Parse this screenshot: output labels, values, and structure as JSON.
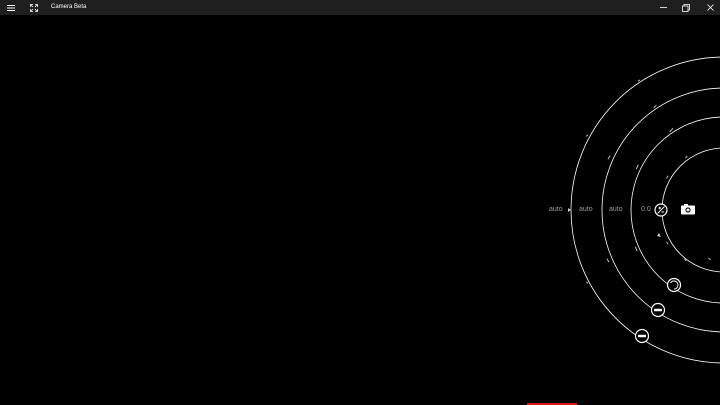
{
  "window": {
    "title": "Camera Beta",
    "icons": [
      "hamburger-menu-icon",
      "fullscreen-icon",
      "minimize-icon",
      "restore-icon",
      "close-icon"
    ]
  },
  "settings": {
    "values": [
      {
        "id": "white-balance",
        "value": "auto"
      },
      {
        "id": "focus",
        "value": "auto"
      },
      {
        "id": "shutter-speed",
        "value": "auto"
      },
      {
        "id": "exposure",
        "value": "0.0"
      }
    ]
  },
  "controls": {
    "shutter": "camera-shutter-icon",
    "exposure_knob": "exposure-knob-icon",
    "dial_buttons": [
      "focus-icon",
      "iso-icon",
      "white-balance-icon"
    ]
  },
  "colors": {
    "background": "#000000",
    "titlebar": "#1f1f1f",
    "dial_stroke": "#ffffff",
    "label": "#9a9a9a",
    "accent": "#d11919"
  }
}
